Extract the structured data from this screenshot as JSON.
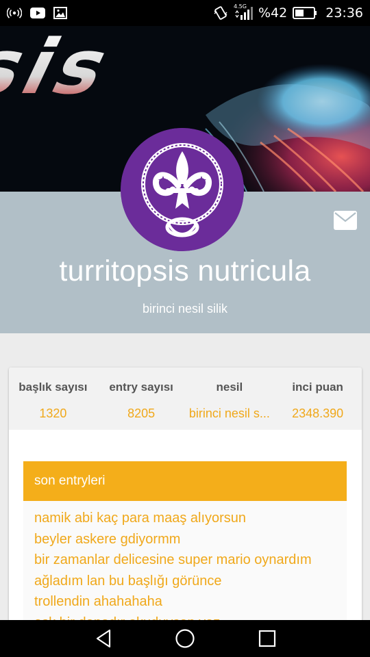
{
  "status_bar": {
    "network_label": "4.5G",
    "battery_percent": "%42",
    "time": "23:36",
    "icons": [
      "hotspot-icon",
      "youtube-icon",
      "gallery-icon",
      "vibrate-icon",
      "signal-icon",
      "battery-icon"
    ]
  },
  "banner": {
    "logo_text": "sis"
  },
  "profile": {
    "username": "turritopsis nutricula",
    "generation": "birinci nesil silik",
    "avatar_icon": "fleur-de-lis-icon",
    "message_icon": "mail-icon"
  },
  "stats": [
    {
      "label": "başlık sayısı",
      "value": "1320"
    },
    {
      "label": "entry sayısı",
      "value": "8205"
    },
    {
      "label": "nesil",
      "value": "birinci nesil s..."
    },
    {
      "label": "inci puan",
      "value": "2348.390"
    }
  ],
  "entries": {
    "title": "son entryleri",
    "items": [
      "namik abi kaç para maaş alıyorsun",
      "beyler askere gdiyormm",
      "bir zamanlar delicesine super mario oynardım",
      "ağladım lan bu başlığı görünce",
      "trollendin ahahahaha",
      "aşk bir danadır okuduysan yaz"
    ]
  },
  "colors": {
    "accent": "#f4ae1a",
    "header_bg": "#b1bfc7",
    "avatar_bg": "#6b2c9a"
  },
  "nav_bar": {
    "icons": [
      "back-icon",
      "home-icon",
      "recents-icon"
    ]
  }
}
